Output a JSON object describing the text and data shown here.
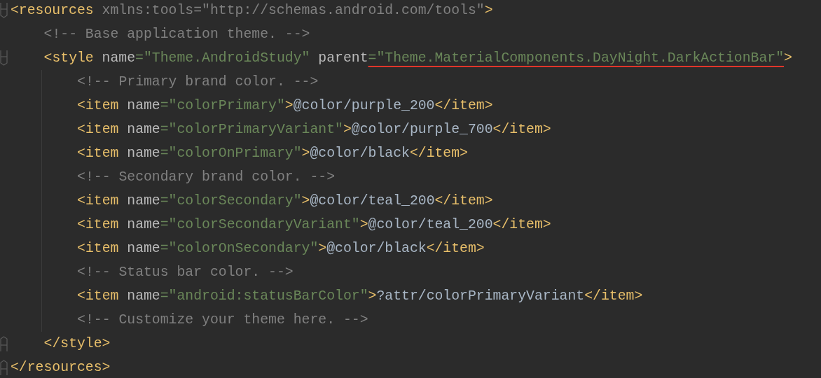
{
  "editor": {
    "lines": [
      {
        "tokens": [
          {
            "kind": "tag",
            "text": "<resources"
          },
          {
            "kind": "unused",
            "text": " xmlns:tools=\"http://schemas.android.com/tools\""
          },
          {
            "kind": "tag",
            "text": ">"
          }
        ],
        "children": [
          {
            "tokens": [
              {
                "kind": "comment",
                "text": "<!-- Base application theme. -->"
              }
            ]
          },
          {
            "tokens": [
              {
                "kind": "tag",
                "text": "<style"
              },
              {
                "kind": "attr",
                "text": " name"
              },
              {
                "kind": "string",
                "text": "=\"Theme.AndroidStudy\""
              },
              {
                "kind": "attr",
                "text": " parent"
              },
              {
                "kind": "string",
                "text": "=\"Theme.MaterialComponents.DayNight.DarkActionBar\"",
                "underlined": true
              },
              {
                "kind": "tag",
                "text": ">"
              }
            ],
            "children": [
              {
                "tokens": [
                  {
                    "kind": "comment",
                    "text": "<!-- Primary brand color. -->"
                  }
                ]
              },
              {
                "tokens": [
                  {
                    "kind": "tag",
                    "text": "<item"
                  },
                  {
                    "kind": "attr",
                    "text": " name"
                  },
                  {
                    "kind": "string",
                    "text": "=\"colorPrimary\""
                  },
                  {
                    "kind": "tag",
                    "text": ">"
                  },
                  {
                    "kind": "text",
                    "text": "@color/purple_200"
                  },
                  {
                    "kind": "tag",
                    "text": "</item>"
                  }
                ]
              },
              {
                "tokens": [
                  {
                    "kind": "tag",
                    "text": "<item"
                  },
                  {
                    "kind": "attr",
                    "text": " name"
                  },
                  {
                    "kind": "string",
                    "text": "=\"colorPrimaryVariant\""
                  },
                  {
                    "kind": "tag",
                    "text": ">"
                  },
                  {
                    "kind": "text",
                    "text": "@color/purple_700"
                  },
                  {
                    "kind": "tag",
                    "text": "</item>"
                  }
                ]
              },
              {
                "tokens": [
                  {
                    "kind": "tag",
                    "text": "<item"
                  },
                  {
                    "kind": "attr",
                    "text": " name"
                  },
                  {
                    "kind": "string",
                    "text": "=\"colorOnPrimary\""
                  },
                  {
                    "kind": "tag",
                    "text": ">"
                  },
                  {
                    "kind": "text",
                    "text": "@color/black"
                  },
                  {
                    "kind": "tag",
                    "text": "</item>"
                  }
                ]
              },
              {
                "tokens": [
                  {
                    "kind": "comment",
                    "text": "<!-- Secondary brand color. -->"
                  }
                ]
              },
              {
                "tokens": [
                  {
                    "kind": "tag",
                    "text": "<item"
                  },
                  {
                    "kind": "attr",
                    "text": " name"
                  },
                  {
                    "kind": "string",
                    "text": "=\"colorSecondary\""
                  },
                  {
                    "kind": "tag",
                    "text": ">"
                  },
                  {
                    "kind": "text",
                    "text": "@color/teal_200"
                  },
                  {
                    "kind": "tag",
                    "text": "</item>"
                  }
                ]
              },
              {
                "tokens": [
                  {
                    "kind": "tag",
                    "text": "<item"
                  },
                  {
                    "kind": "attr",
                    "text": " name"
                  },
                  {
                    "kind": "string",
                    "text": "=\"colorSecondaryVariant\""
                  },
                  {
                    "kind": "tag",
                    "text": ">"
                  },
                  {
                    "kind": "text",
                    "text": "@color/teal_200"
                  },
                  {
                    "kind": "tag",
                    "text": "</item>"
                  }
                ]
              },
              {
                "tokens": [
                  {
                    "kind": "tag",
                    "text": "<item"
                  },
                  {
                    "kind": "attr",
                    "text": " name"
                  },
                  {
                    "kind": "string",
                    "text": "=\"colorOnSecondary\""
                  },
                  {
                    "kind": "tag",
                    "text": ">"
                  },
                  {
                    "kind": "text",
                    "text": "@color/black"
                  },
                  {
                    "kind": "tag",
                    "text": "</item>"
                  }
                ]
              },
              {
                "tokens": [
                  {
                    "kind": "comment",
                    "text": "<!-- Status bar color. -->"
                  }
                ]
              },
              {
                "tokens": [
                  {
                    "kind": "tag",
                    "text": "<item"
                  },
                  {
                    "kind": "attr",
                    "text": " name"
                  },
                  {
                    "kind": "string",
                    "text": "=\"android:statusBarColor\""
                  },
                  {
                    "kind": "tag",
                    "text": ">"
                  },
                  {
                    "kind": "text",
                    "text": "?attr/colorPrimaryVariant"
                  },
                  {
                    "kind": "tag",
                    "text": "</item>"
                  }
                ]
              },
              {
                "tokens": [
                  {
                    "kind": "comment",
                    "text": "<!-- Customize your theme here. -->"
                  }
                ]
              }
            ],
            "close": [
              {
                "kind": "tag",
                "text": "</style>"
              }
            ]
          }
        ],
        "close": [
          {
            "kind": "tag",
            "text": "</resources>"
          }
        ]
      }
    ]
  }
}
